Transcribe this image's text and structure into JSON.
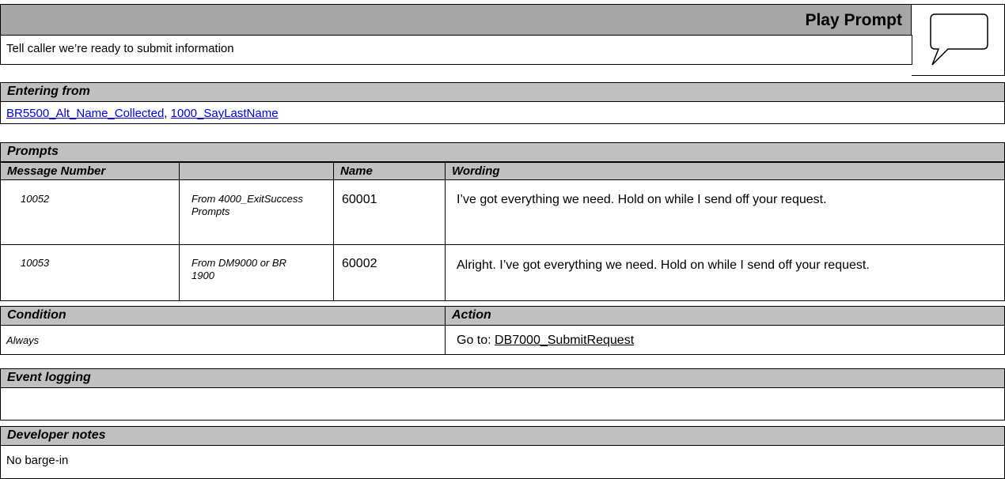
{
  "header": {
    "title": "Play Prompt",
    "description": "Tell caller we’re ready to submit information"
  },
  "entering_from": {
    "label": "Entering from",
    "links": [
      "BR5500_Alt_Name_Collected",
      "1000_SayLastName"
    ],
    "separator": ","
  },
  "prompts": {
    "label": "Prompts",
    "columns": [
      "Message Number",
      "",
      "Name",
      "Wording"
    ],
    "rows": [
      {
        "message_number": "10052",
        "source": "From 4000_ExitSuccess Prompts",
        "name": "60001",
        "wording": "I’ve got everything we need. Hold on while I send off your request."
      },
      {
        "message_number": "10053",
        "source": "From DM9000 or BR 1900",
        "name": "60002",
        "wording": "Alright. I’ve got everything we need. Hold on while I send off your request."
      }
    ]
  },
  "condition_action": {
    "condition_label": "Condition",
    "action_label": "Action",
    "condition_value": "Always",
    "action_prefix": "Go to:",
    "action_target": "DB7000_SubmitRequest"
  },
  "event_logging": {
    "label": "Event logging",
    "value": ""
  },
  "developer_notes": {
    "label": "Developer notes",
    "value": "No barge-in"
  },
  "icon": "speech-bubble-icon"
}
